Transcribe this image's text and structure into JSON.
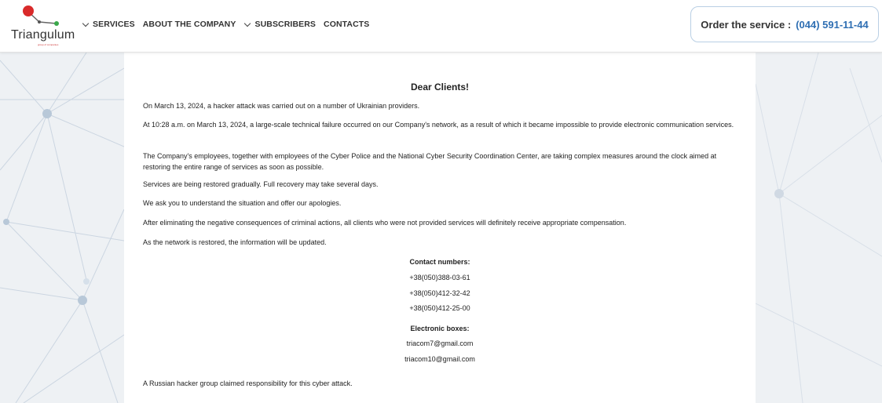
{
  "header": {
    "logo_text": "Triangulum",
    "logo_subtext": "group of companies",
    "nav": [
      {
        "label": "SERVICES",
        "has_dropdown": true
      },
      {
        "label": "ABOUT THE COMPANY",
        "has_dropdown": false
      },
      {
        "label": "SUBSCRIBERS",
        "has_dropdown": true
      },
      {
        "label": "CONTACTS",
        "has_dropdown": false
      }
    ],
    "order_label": "Order the service :",
    "order_phone": "(044) 591-11-44"
  },
  "notice": {
    "title": "Dear Clients!",
    "paragraphs": [
      "On March 13, 2024, a hacker attack was carried out on a number of Ukrainian providers.",
      "At 10:28 a.m. on March 13, 2024, a large-scale technical failure occurred on our Company's network, as a result of which it became impossible to provide electronic communication services.",
      "The Company's employees, together with employees of the Cyber Police and the National Cyber Security Coordination Center, are taking complex measures around the clock aimed at restoring the entire range of services as soon as possible.",
      "Services are being restored gradually. Full recovery may take several days.",
      "We ask you to understand the situation and offer our apologies.",
      "After eliminating the negative consequences of criminal actions, all clients who were not provided services will definitely receive appropriate compensation.",
      "As the network is restored, the information will be updated."
    ],
    "contacts_heading": "Contact numbers:",
    "phones": [
      "+38(050)388-03-61",
      "+38(050)412-32-42",
      "+38(050)412-25-00"
    ],
    "emails_heading": "Electronic boxes:",
    "emails": [
      "triacom7@gmail.com",
      "triacom10@gmail.com"
    ],
    "footer": "A Russian hacker group claimed responsibility for this cyber attack."
  },
  "colors": {
    "accent": "#2f6fb3",
    "order_border": "#b9cfe4",
    "background": "#eef1f4"
  }
}
